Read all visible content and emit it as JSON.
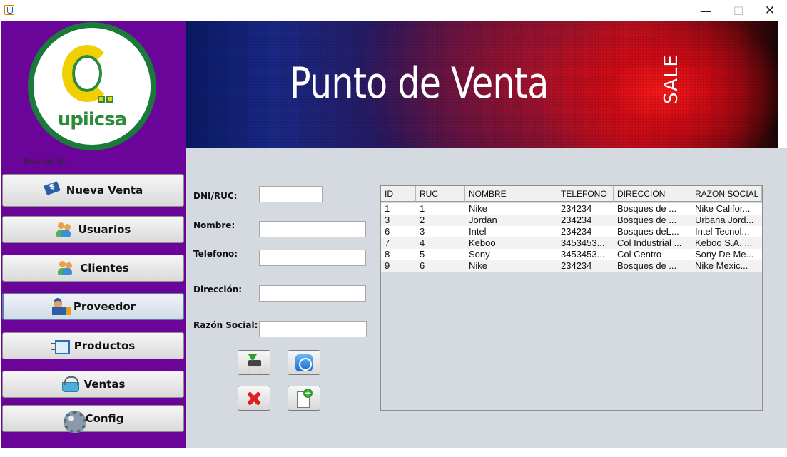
{
  "window": {
    "minimize_glyph": "—",
    "maximize_glyph": "☐",
    "close_glyph": "✕"
  },
  "sidebar": {
    "logo_text": "upiicsa",
    "user_name": "Brian Murillo",
    "items": [
      {
        "label": "Nueva Venta",
        "icon": "money-hand-icon"
      },
      {
        "label": "Usuarios",
        "icon": "users-icon"
      },
      {
        "label": "Clientes",
        "icon": "clients-icon"
      },
      {
        "label": "Proveedor",
        "icon": "supplier-icon"
      },
      {
        "label": "Productos",
        "icon": "box-icon"
      },
      {
        "label": "Ventas",
        "icon": "basket-icon"
      },
      {
        "label": "Config",
        "icon": "gear-icon"
      }
    ]
  },
  "banner": {
    "title": "Punto de Venta",
    "sale": "SALE"
  },
  "form": {
    "dni_label": "DNI/RUC:",
    "nombre_label": "Nombre:",
    "telefono_label": "Telefono:",
    "direccion_label": "Dirección:",
    "razon_label": "Razón Social:",
    "dni_value": "",
    "nombre_value": "",
    "telefono_value": "",
    "direccion_value": "",
    "razon_value": ""
  },
  "actions": {
    "save_icon": "save-icon",
    "appstore_icon": "app-store-icon",
    "delete_icon": "delete-icon",
    "new_icon": "new-document-icon"
  },
  "table": {
    "columns": [
      "ID",
      "RUC",
      "NOMBRE",
      "TELEFONO",
      "DIRECCIÓN",
      "RAZON SOCIAL"
    ],
    "rows": [
      [
        "1",
        "1",
        "Nike",
        "234234",
        "Bosques de ...",
        " Nike Califor..."
      ],
      [
        "3",
        "2",
        "Jordan",
        "234234",
        "Bosques de ...",
        "Urbana Jord..."
      ],
      [
        "6",
        "3",
        "Intel",
        "234234",
        "Bosques deL...",
        "Intel Tecnol..."
      ],
      [
        "7",
        "4",
        "Keboo",
        "3453453...",
        "Col Industrial ...",
        "Keboo S.A. ..."
      ],
      [
        "8",
        "5",
        "Sony",
        "3453453...",
        "Col Centro",
        "Sony De Me..."
      ],
      [
        "9",
        "6",
        "Nike",
        "234234",
        "Bosques de ...",
        " Nike Mexic..."
      ]
    ]
  },
  "colors": {
    "sidebar_bg": "#6b0599",
    "main_bg": "#d5d9e0",
    "row_alt": "#f2f2f2"
  }
}
